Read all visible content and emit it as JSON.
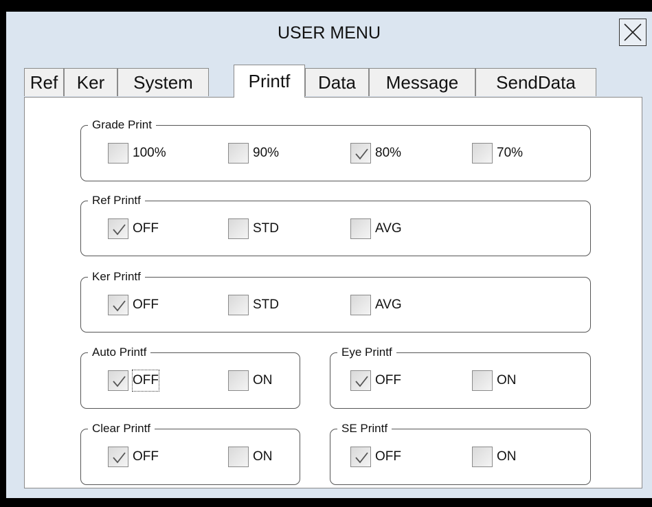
{
  "window": {
    "title": "USER MENU"
  },
  "tabs": [
    {
      "label": "Ref"
    },
    {
      "label": "Ker"
    },
    {
      "label": "System"
    },
    {
      "label": "Printf",
      "active": true
    },
    {
      "label": "Data"
    },
    {
      "label": "Message"
    },
    {
      "label": "SendData"
    }
  ],
  "groups": {
    "grade_print": {
      "title": "Grade Print",
      "options": [
        {
          "label": "100%",
          "checked": false
        },
        {
          "label": "90%",
          "checked": false
        },
        {
          "label": "80%",
          "checked": true
        },
        {
          "label": "70%",
          "checked": false
        }
      ]
    },
    "ref_printf": {
      "title": "Ref Printf",
      "options": [
        {
          "label": "OFF",
          "checked": true
        },
        {
          "label": "STD",
          "checked": false
        },
        {
          "label": "AVG",
          "checked": false
        }
      ]
    },
    "ker_printf": {
      "title": "Ker Printf",
      "options": [
        {
          "label": "OFF",
          "checked": true
        },
        {
          "label": "STD",
          "checked": false
        },
        {
          "label": "AVG",
          "checked": false
        }
      ]
    },
    "auto_printf": {
      "title": "Auto Printf",
      "options": [
        {
          "label": "OFF",
          "checked": true,
          "focused": true
        },
        {
          "label": "ON",
          "checked": false
        }
      ]
    },
    "eye_printf": {
      "title": "Eye Printf",
      "options": [
        {
          "label": "OFF",
          "checked": true
        },
        {
          "label": "ON",
          "checked": false
        }
      ]
    },
    "clear_printf": {
      "title": "Clear Printf",
      "options": [
        {
          "label": "OFF",
          "checked": true
        },
        {
          "label": "ON",
          "checked": false
        }
      ]
    },
    "se_printf": {
      "title": "SE Printf",
      "options": [
        {
          "label": "OFF",
          "checked": true
        },
        {
          "label": "ON",
          "checked": false
        }
      ]
    }
  }
}
